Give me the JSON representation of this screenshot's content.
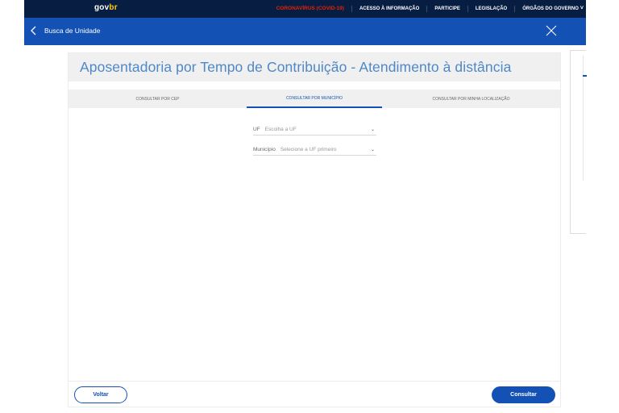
{
  "header": {
    "logo_main": "gov",
    "logo_accent": "br",
    "nav": [
      "CORONAVÍRUS (COVID-19)",
      "ACESSO À INFORMAÇÃO",
      "PARTICIPE",
      "LEGISLAÇÃO",
      "ÓRGÃOS DO GOVERNO"
    ]
  },
  "subheader": {
    "title": "Busca de Unidade"
  },
  "page": {
    "title": "Aposentadoria por Tempo de Contribuição - Atendimento à distância",
    "tabs": [
      {
        "label": "CONSULTAR POR CEP",
        "active": false
      },
      {
        "label": "CONSULTAR POR MUNICÍPIO",
        "active": true
      },
      {
        "label": "CONSULTAR POR MINHA LOCALIZAÇÃO",
        "active": false
      }
    ],
    "fields": {
      "uf": {
        "label": "UF",
        "value": "Escolha a UF"
      },
      "municipio": {
        "label": "Município",
        "value": "Selecione a UF primeiro"
      }
    },
    "buttons": {
      "back": "Voltar",
      "submit": "Consultar"
    }
  },
  "colors": {
    "header_bg": "#071d41",
    "primary": "#1351b4",
    "covid": "#e52207",
    "title": "#4f88c7"
  }
}
